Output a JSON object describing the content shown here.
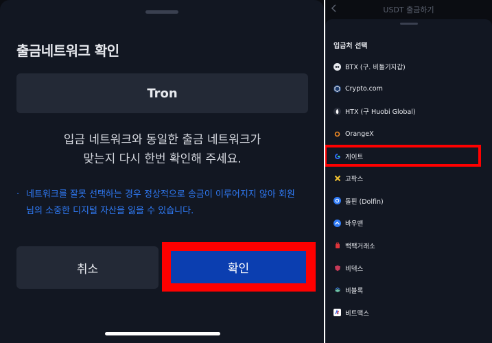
{
  "left_panel": {
    "title": "출금네트워크 확인",
    "network_name": "Tron",
    "message_line1": "입금 네트워크와 동일한 출금 네트워크가",
    "message_line2": "맞는지 다시 한번 확인해 주세요.",
    "warning_bullet": "·",
    "warning_text": "네트워크를 잘못 선택하는 경우 정상적으로 송금이 이루어지지 않아 회원님의 소중한 디지털 자산을 잃을 수 있습니다.",
    "cancel_label": "취소",
    "confirm_label": "확인"
  },
  "right_panel": {
    "header_title": "USDT 출금하기",
    "section_heading": "입금처 선택",
    "exchanges": [
      {
        "label": "BTX (구. 비둘기지갑)",
        "icon": "btx-icon"
      },
      {
        "label": "Crypto.com",
        "icon": "cryptocom-icon"
      },
      {
        "label": "HTX (구 Huobi Global)",
        "icon": "htx-icon"
      },
      {
        "label": "OrangeX",
        "icon": "orangex-icon"
      },
      {
        "label": "게이트",
        "icon": "gate-icon"
      },
      {
        "label": "고팍스",
        "icon": "gopax-icon"
      },
      {
        "label": "돌핀 (Dolfin)",
        "icon": "dolfin-icon"
      },
      {
        "label": "바우맨",
        "icon": "bauman-icon"
      },
      {
        "label": "백팩거래소",
        "icon": "backpack-icon"
      },
      {
        "label": "비덱스",
        "icon": "bidex-icon"
      },
      {
        "label": "비블록",
        "icon": "biblock-icon"
      },
      {
        "label": "비트맥스",
        "icon": "bitmax-icon"
      }
    ]
  },
  "colors": {
    "highlight": "#ff0000",
    "confirm_bg": "#0b3eb0",
    "warning_text": "#2f7af5"
  }
}
